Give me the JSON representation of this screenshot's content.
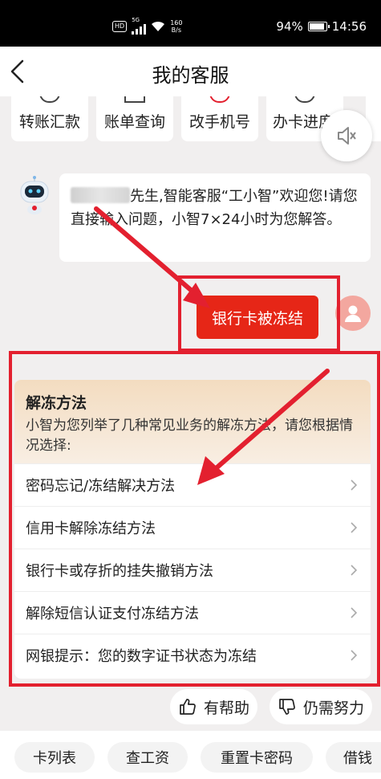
{
  "status_bar": {
    "hd": "HD",
    "network": "5G",
    "speed_value": "160",
    "speed_unit": "B/s",
    "battery": "94%",
    "battery_level": 0.94,
    "time": "14:56"
  },
  "nav": {
    "title": "我的客服"
  },
  "quick_services": [
    "转账汇款",
    "账单查询",
    "改手机号",
    "办卡进度"
  ],
  "chat": {
    "greeting": {
      "name_suffix": "先生,智能客服“工小智”欢迎您!请您直接输入问题，小智7×24小时为您解答。"
    },
    "user_message": "银行卡被冻结"
  },
  "unfreeze_card": {
    "title": "解冻方法",
    "description": "小智为您列举了几种常见业务的解冻方法，请您根据情况选择:",
    "items": [
      "密码忘记/冻结解决方法",
      "信用卡解除冻结方法",
      "银行卡或存折的挂失撤销方法",
      "解除短信认证支付冻结方法",
      "网银提示：您的数字证书状态为冻结"
    ]
  },
  "feedback": {
    "helpful": "有帮助",
    "needs_work": "仍需努力"
  },
  "bottom_actions": [
    "卡列表",
    "查工资",
    "重置卡密码",
    "借钱"
  ],
  "colors": {
    "accent_red": "#e62617",
    "annotation_red": "#e3202f",
    "card_header": "#f3dcc0"
  }
}
